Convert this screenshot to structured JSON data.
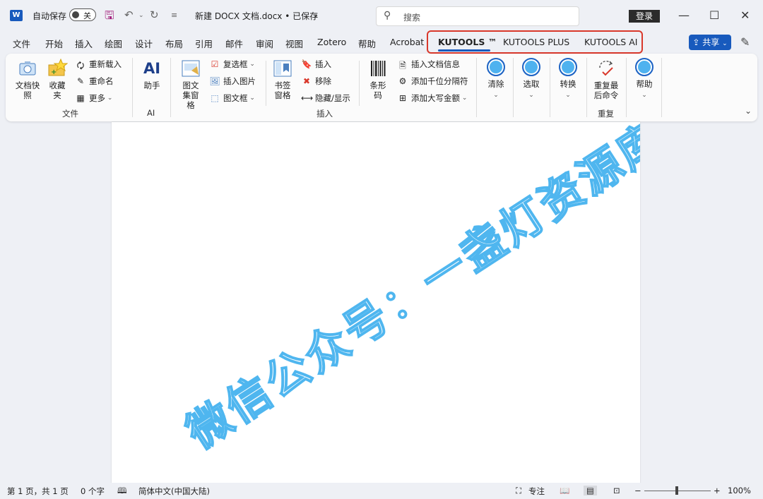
{
  "titlebar": {
    "autosave_label": "自动保存",
    "autosave_state": "关",
    "doc_title": "新建 DOCX 文档.docx • 已保存",
    "search_placeholder": "搜索",
    "login_label": "登录"
  },
  "tabs": [
    {
      "label": "文件"
    },
    {
      "label": "开始"
    },
    {
      "label": "插入"
    },
    {
      "label": "绘图"
    },
    {
      "label": "设计"
    },
    {
      "label": "布局"
    },
    {
      "label": "引用"
    },
    {
      "label": "邮件"
    },
    {
      "label": "审阅"
    },
    {
      "label": "视图"
    },
    {
      "label": "Zotero"
    },
    {
      "label": "帮助"
    },
    {
      "label": "Acrobat"
    },
    {
      "label": "KUTOOLS ™"
    },
    {
      "label": "KUTOOLS PLUS"
    },
    {
      "label": "KUTOOLS AI"
    }
  ],
  "share_label": "共享",
  "ribbon": {
    "file_group": {
      "label": "文件",
      "snapshot": "文档快照",
      "favorites": "收藏夹",
      "reload": "重新载入",
      "rename": "重命名",
      "more": "更多"
    },
    "ai_group": {
      "label": "AI",
      "assistant_title": "AI",
      "assistant": "助手"
    },
    "insert_group": {
      "label": "插入",
      "image_set": "图文集窗格",
      "checkbox": "复选框",
      "insert_picture": "插入图片",
      "textbox": "图文框",
      "bookmark_pane": "书签窗格",
      "insert": "插入",
      "remove": "移除",
      "hide_show": "隐藏/显示",
      "barcode": "条形码",
      "insert_doc_info": "插入文档信息",
      "add_thousands": "添加千位分隔符",
      "add_uppercase": "添加大写金额"
    },
    "clear": "清除",
    "select": "选取",
    "convert": "转换",
    "repeat_group": {
      "label": "重复",
      "repeat_last": "重复最后命令"
    },
    "help": "帮助"
  },
  "watermark": "微信公众号：一盏灯资源库",
  "statusbar": {
    "page": "第 1 页，共 1 页",
    "words": "0 个字",
    "language": "简体中文(中国大陆)",
    "focus": "专注",
    "zoom": "100%"
  },
  "colors": {
    "accent": "#185abd",
    "highlight": "#d9382b",
    "watermark": "#4fb6ef"
  }
}
